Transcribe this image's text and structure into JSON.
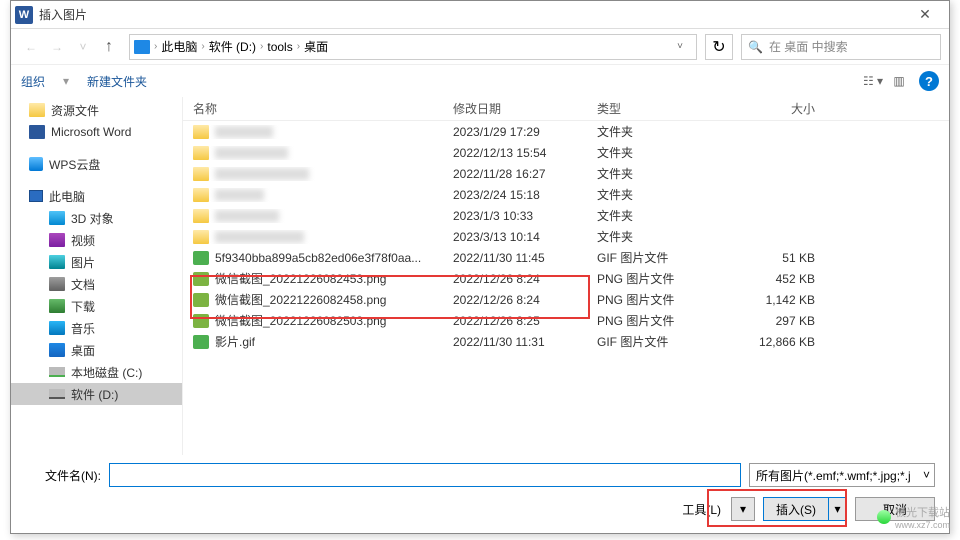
{
  "title": "插入图片",
  "breadcrumb": {
    "root": "此电脑",
    "drive": "软件 (D:)",
    "dir1": "tools",
    "dir2": "桌面"
  },
  "search": {
    "placeholder": "在 桌面 中搜索"
  },
  "toolbar": {
    "organize": "组织",
    "newfolder": "新建文件夹"
  },
  "columns": {
    "name": "名称",
    "date": "修改日期",
    "type": "类型",
    "size": "大小"
  },
  "sidebar": {
    "res": "资源文件",
    "word": "Microsoft Word",
    "wps": "WPS云盘",
    "pc": "此电脑",
    "obj3d": "3D 对象",
    "video": "视频",
    "pic": "图片",
    "doc": "文档",
    "download": "下载",
    "music": "音乐",
    "desktop": "桌面",
    "diskc": "本地磁盘 (C:)",
    "diskd": "软件 (D:)"
  },
  "files": [
    {
      "name": "",
      "date": "2023/1/29 17:29",
      "type": "文件夹",
      "size": ""
    },
    {
      "name": "",
      "date": "2022/12/13 15:54",
      "type": "文件夹",
      "size": ""
    },
    {
      "name": "",
      "date": "2022/11/28 16:27",
      "type": "文件夹",
      "size": ""
    },
    {
      "name": "",
      "date": "2023/2/24 15:18",
      "type": "文件夹",
      "size": ""
    },
    {
      "name": "",
      "date": "2023/1/3 10:33",
      "type": "文件夹",
      "size": ""
    },
    {
      "name": "",
      "date": "2023/3/13 10:14",
      "type": "文件夹",
      "size": ""
    },
    {
      "name": "5f9340bba899a5cb82ed06e3f78f0aa...",
      "date": "2022/11/30 11:45",
      "type": "GIF 图片文件",
      "size": "51 KB",
      "icon": "gif"
    },
    {
      "name": "微信截图_20221226082453.png",
      "date": "2022/12/26 8:24",
      "type": "PNG 图片文件",
      "size": "452 KB",
      "icon": "png"
    },
    {
      "name": "微信截图_20221226082458.png",
      "date": "2022/12/26 8:24",
      "type": "PNG 图片文件",
      "size": "1,142 KB",
      "icon": "png"
    },
    {
      "name": "微信截图_20221226082503.png",
      "date": "2022/12/26 8:25",
      "type": "PNG 图片文件",
      "size": "297 KB",
      "icon": "png"
    },
    {
      "name": "影片.gif",
      "date": "2022/11/30 11:31",
      "type": "GIF 图片文件",
      "size": "12,866 KB",
      "icon": "gif"
    }
  ],
  "footer": {
    "filename_label": "文件名(N):",
    "filetype": "所有图片(*.emf;*.wmf;*.jpg;*.j",
    "tools": "工具(L)",
    "insert": "插入(S)",
    "cancel": "取消"
  },
  "watermark": {
    "name": "极光下载站",
    "url": "www.xz7.com"
  }
}
